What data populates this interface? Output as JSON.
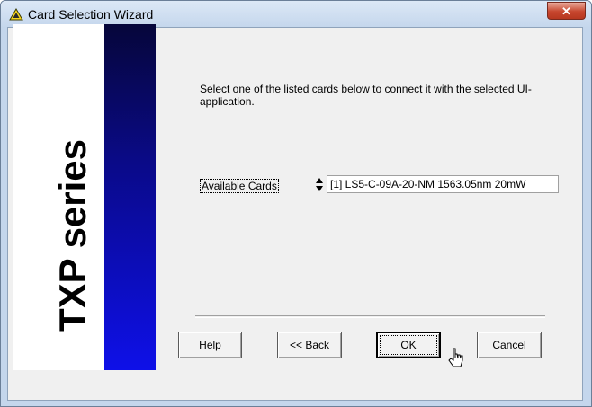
{
  "window": {
    "title": "Card Selection Wizard",
    "close_glyph": "✕",
    "icon": "warning-triangle-icon"
  },
  "banner": {
    "text": "TXP series",
    "accent_colors": [
      "#06063a",
      "#0e10e8"
    ]
  },
  "content": {
    "instruction": "Select one of the listed cards below to connect it with the selected UI-application.",
    "available_cards_label": "Available Cards",
    "selected_card": "[1] LS5-C-09A-20-NM 1563.05nm 20mW"
  },
  "buttons": {
    "help": "Help",
    "back": "<< Back",
    "ok": "OK",
    "cancel": "Cancel"
  }
}
